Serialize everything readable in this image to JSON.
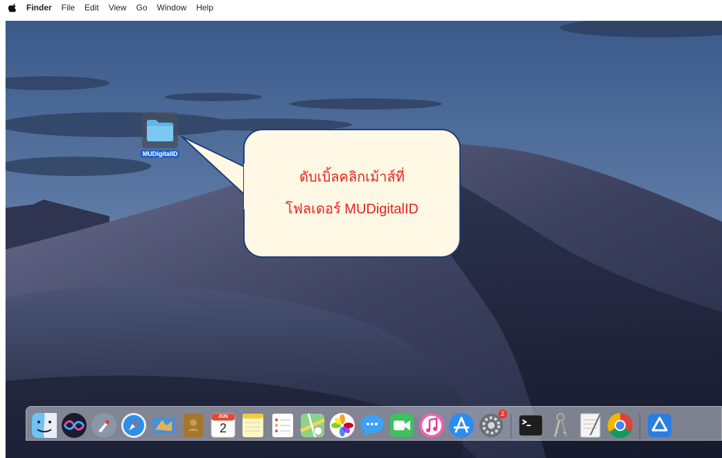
{
  "menubar": {
    "apple_icon": "apple-icon",
    "app_name": "Finder",
    "items": [
      "File",
      "Edit",
      "View",
      "Go",
      "Window",
      "Help"
    ]
  },
  "desktop": {
    "folder": {
      "name": "MUDigitalID",
      "icon": "folder-icon"
    }
  },
  "callout": {
    "line1": "ดับเบิ้ลคลิกเม้าส์ที่",
    "line2": "โฟลเดอร์ MUDigitalID",
    "text_color": "#e8211f",
    "fill_color": "#fff8e4",
    "border_color": "#1e3c78"
  },
  "dock": {
    "apps": [
      "finder-icon",
      "siri-icon",
      "launchpad-icon",
      "safari-icon",
      "mail-icon",
      "contacts-icon",
      "calendar-icon",
      "notes-icon",
      "reminders-icon",
      "maps-icon",
      "photos-icon",
      "messages-icon",
      "facetime-icon",
      "itunes-icon",
      "app-store-icon",
      "system-preferences-icon",
      "terminal-icon",
      "keychain-icon",
      "textedit-icon",
      "chrome-icon",
      "drive-icon"
    ],
    "calendar": {
      "month": "JUN",
      "day": "2"
    },
    "system_preferences_badge": "2"
  }
}
